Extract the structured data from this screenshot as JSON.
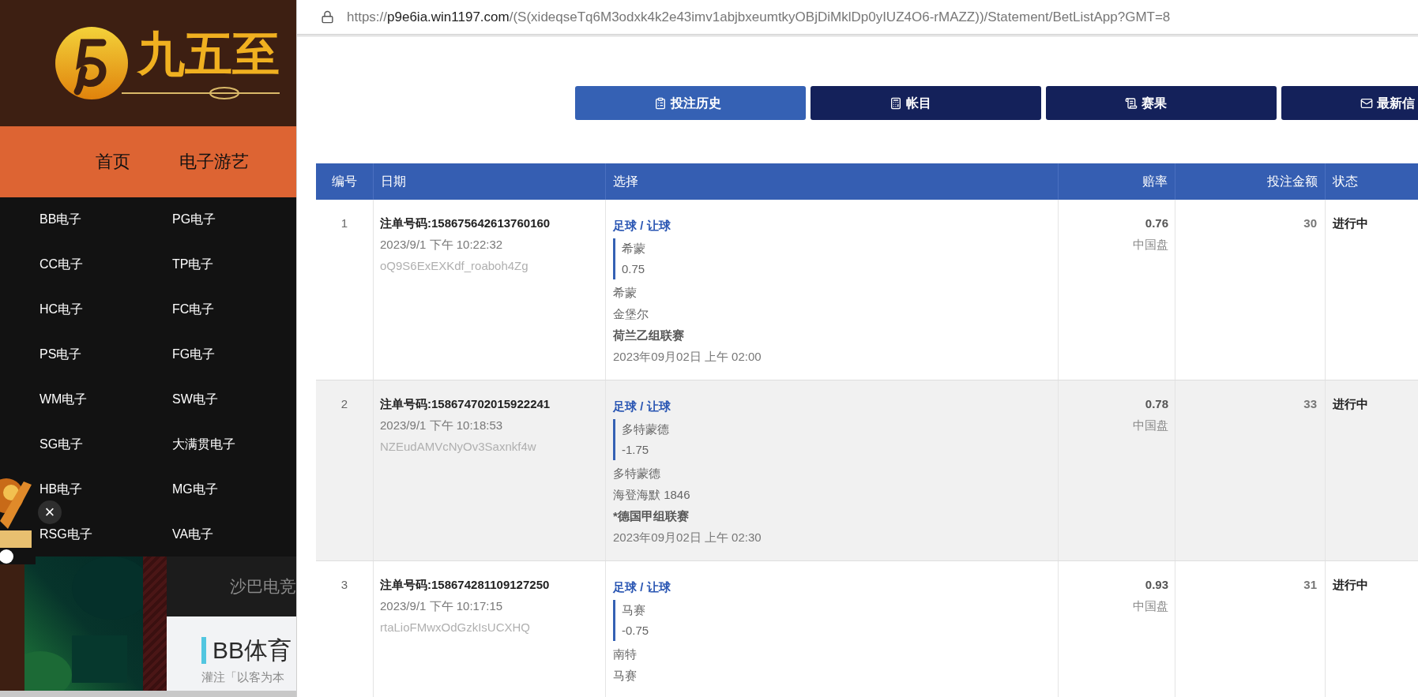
{
  "background_page": {
    "logo": {
      "text": "九五至"
    },
    "nav": [
      {
        "label": "首页"
      },
      {
        "label": "电子游艺"
      }
    ],
    "menu": [
      {
        "label": "BB电子"
      },
      {
        "label": "PG电子"
      },
      {
        "label": "CC电子"
      },
      {
        "label": "TP电子"
      },
      {
        "label": "HC电子"
      },
      {
        "label": "FC电子"
      },
      {
        "label": "PS电子"
      },
      {
        "label": "FG电子"
      },
      {
        "label": "WM电子"
      },
      {
        "label": "SW电子"
      },
      {
        "label": "SG电子"
      },
      {
        "label": "大满贯电子"
      },
      {
        "label": "HB电子"
      },
      {
        "label": "MG电子"
      },
      {
        "label": "RSG电子"
      },
      {
        "label": "VA电子"
      }
    ],
    "popup": {
      "close": "×"
    },
    "esports_label": "沙巴电竞",
    "promo": {
      "title": "BB体育",
      "text": "灌注「以客为本"
    }
  },
  "browser": {
    "address": {
      "scheme": "https://",
      "host": "p9e6ia.win1197.com",
      "path": "/(S(xideqseTq6M3odxk4k2e43imv1abjbxeumtkyOBjDiMklDp0yIUZ4O6-rMAZZ))/Statement/BetListApp?GMT=8"
    }
  },
  "tabs": [
    {
      "label": "投注历史",
      "kind": "history",
      "selected": true
    },
    {
      "label": "帐目",
      "kind": "account",
      "selected": false
    },
    {
      "label": "赛果",
      "kind": "results",
      "selected": false
    },
    {
      "label": "最新信",
      "kind": "messages",
      "selected": false
    }
  ],
  "table": {
    "columns": [
      "编号",
      "日期",
      "选择",
      "赔率",
      "投注金额",
      "状态"
    ],
    "rows": [
      {
        "no": "1",
        "ticket": "注单号码:158675642613760160",
        "time": "2023/9/1 下午 10:22:32",
        "code": "oQ9S6ExEXKdf_roaboh4Zg",
        "bet_type": "足球 / 让球",
        "pick": "希蒙",
        "handicap": "0.75",
        "home": "希蒙",
        "away": "金堡尔",
        "league": "荷兰乙组联赛",
        "kickoff": "2023年09月02日 上午 02:00",
        "odds": "0.76",
        "odds_type": "中国盘",
        "stake": "30",
        "status": "进行中",
        "shaded": false
      },
      {
        "no": "2",
        "ticket": "注单号码:158674702015922241",
        "time": "2023/9/1 下午 10:18:53",
        "code": "NZEudAMVcNyOv3Saxnkf4w",
        "bet_type": "足球 / 让球",
        "pick": "多特蒙德",
        "handicap": "-1.75",
        "home": "多特蒙德",
        "away": "海登海默 1846",
        "league": "*德国甲组联赛",
        "kickoff": "2023年09月02日 上午 02:30",
        "odds": "0.78",
        "odds_type": "中国盘",
        "stake": "33",
        "status": "进行中",
        "shaded": true
      },
      {
        "no": "3",
        "ticket": "注单号码:158674281109127250",
        "time": "2023/9/1 下午 10:17:15",
        "code": "rtaLioFMwxOdGzkIsUCXHQ",
        "bet_type": "足球 / 让球",
        "pick": "马赛",
        "handicap": "-0.75",
        "home": "南特",
        "away": "马赛",
        "odds": "0.93",
        "odds_type": "中国盘",
        "stake": "31",
        "status": "进行中",
        "shaded": false
      }
    ]
  }
}
